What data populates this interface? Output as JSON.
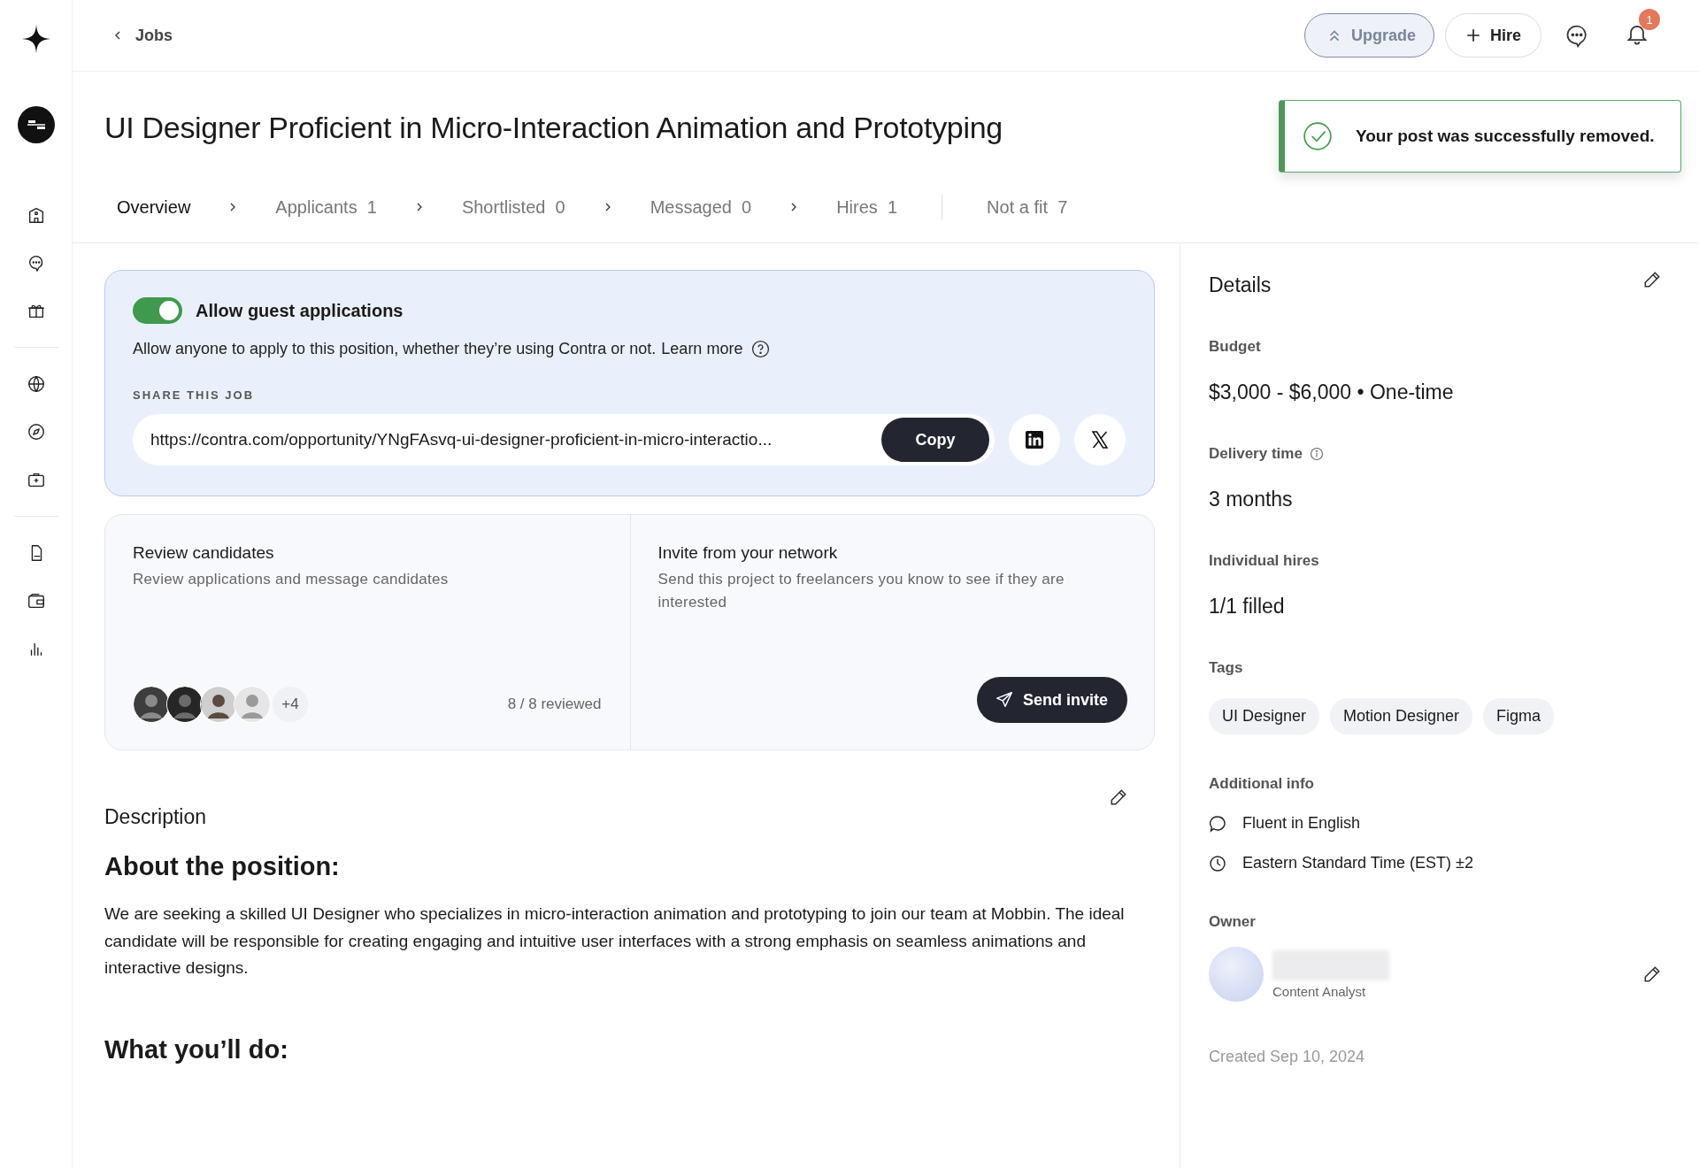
{
  "top_bar": {
    "back_link": "Jobs",
    "upgrade_button": "Upgrade",
    "hire_button": "Hire",
    "notification_badge": "1"
  },
  "title": "UI Designer Proficient in Micro-Interaction Animation and Prototyping",
  "toast": {
    "message": "Your post was successfully removed."
  },
  "tabs": [
    {
      "label": "Overview",
      "kind": "step",
      "selected": true
    },
    {
      "label": "Applicants",
      "count": "1",
      "kind": "step",
      "selected": false
    },
    {
      "label": "Shortlisted",
      "count": "0",
      "kind": "step",
      "selected": false
    },
    {
      "label": "Messaged",
      "count": "0",
      "kind": "step",
      "selected": false
    },
    {
      "label": "Hires",
      "count": "1",
      "kind": "last-step",
      "selected": false
    },
    {
      "label": "Not a fit",
      "count": "7",
      "kind": "aside",
      "selected": false
    }
  ],
  "guest_card": {
    "toggle_label": "Allow guest applications",
    "on": true,
    "description": "Allow anyone to apply to this position, whether they’re using Contra or not.",
    "learn_more": "Learn more",
    "share_label": "SHARE THIS JOB",
    "url": "https://contra.com/opportunity/YNgFAsvq-ui-designer-proficient-in-micro-interactio...",
    "copy_button": "Copy"
  },
  "review": {
    "title": "Review candidates",
    "subtitle": "Review applications and message candidates",
    "extra_count": "+4",
    "reviewed": "8 / 8 reviewed"
  },
  "invite": {
    "title": "Invite from your network",
    "subtitle": "Send this project to freelancers you know to see if they are interested",
    "button": "Send invite"
  },
  "description": {
    "label": "Description",
    "heading": "About the position:",
    "body": "We are seeking a skilled UI Designer who specializes in micro-interaction animation and prototyping to join our team at Mobbin. The ideal candidate will be responsible for creating engaging and intuitive user interfaces with a strong emphasis on seamless animations and interactive designs.",
    "next_heading": "What you’ll do:"
  },
  "details": {
    "title": "Details",
    "fields": [
      {
        "label": "Budget",
        "value": "$3,000 - $6,000 • One-time",
        "info": false
      },
      {
        "label": "Delivery time",
        "value": "3 months",
        "info": true
      },
      {
        "label": "Individual hires",
        "value": "1/1 filled",
        "info": false
      }
    ],
    "tags_label": "Tags",
    "tags": [
      "UI Designer",
      "Motion Designer",
      "Figma"
    ],
    "info_label": "Additional info",
    "info": [
      {
        "kind": "language",
        "text": "Fluent in English"
      },
      {
        "kind": "timezone",
        "text": "Eastern Standard Time (EST) ±2"
      }
    ],
    "owner_label": "Owner",
    "owner_role": "Content Analyst",
    "created": "Created Sep 10, 2024"
  }
}
